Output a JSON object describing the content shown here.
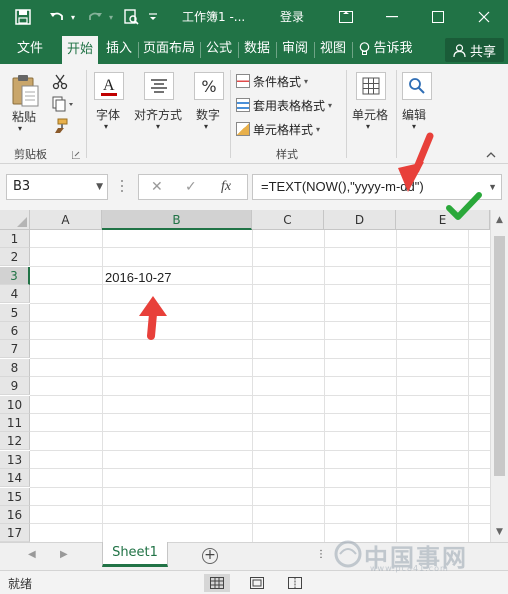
{
  "title_bar": {
    "title": "工作簿1 -...",
    "login": "登录",
    "undo_icon": "undo-icon",
    "redo_icon": "redo-icon"
  },
  "ribbon_tabs": [
    {
      "label": "文件"
    },
    {
      "label": "开始"
    },
    {
      "label": "插入"
    },
    {
      "label": "页面布局"
    },
    {
      "label": "公式"
    },
    {
      "label": "数据"
    },
    {
      "label": "审阅"
    },
    {
      "label": "视图"
    }
  ],
  "tell_me": "告诉我",
  "share": "共享",
  "ribbon": {
    "paste": "粘贴",
    "clipboard_group": "剪贴板",
    "font": "字体",
    "alignment": "对齐方式",
    "number": "数字",
    "conditional_format": "条件格式",
    "format_as_table": "套用表格格式",
    "cell_styles": "单元格样式",
    "styles_group": "样式",
    "cells": "单元格",
    "editing": "编辑"
  },
  "formula_bar": {
    "name_box": "B3",
    "cancel_glyph": "✕",
    "enter_glyph": "✓",
    "fx_label": "fx",
    "formula": "=TEXT(NOW(),\"yyyy-m-dd\")"
  },
  "grid": {
    "columns": [
      "A",
      "B",
      "C",
      "D",
      "E"
    ],
    "rows": [
      "1",
      "2",
      "3",
      "4",
      "5",
      "6",
      "7",
      "8",
      "9",
      "10",
      "11",
      "12",
      "13",
      "14",
      "15",
      "16",
      "17"
    ],
    "cell_b3": "2016-10-27"
  },
  "sheet_tabs": [
    {
      "label": "Sheet1"
    }
  ],
  "add_sheet_glyph": "+",
  "status": "就绪",
  "watermark": {
    "text": "中国事网"
  },
  "colors": {
    "excel_green": "#217346",
    "arrow_red": "#e8403a",
    "check_green": "#2aa83a"
  }
}
